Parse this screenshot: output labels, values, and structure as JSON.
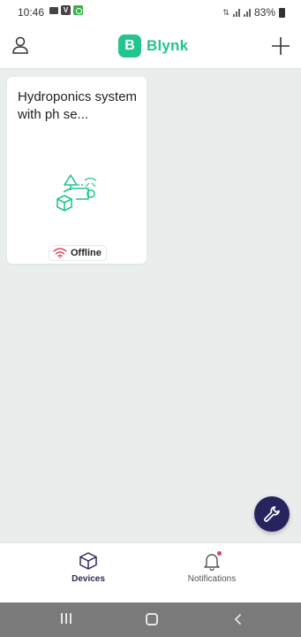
{
  "status_bar": {
    "time": "10:46",
    "battery": "83%",
    "icons": [
      "video-camera-icon",
      "v-app-icon",
      "green-app-icon",
      "data-arrows-icon",
      "signal-icon",
      "signal-icon",
      "battery-icon"
    ]
  },
  "header": {
    "logo_letter": "B",
    "app_name": "Blynk",
    "brand_color": "#23c48e"
  },
  "devices": [
    {
      "name": "Hydroponics system with ph se...",
      "status": "Offline",
      "status_color": "#e0405a"
    }
  ],
  "bottom_nav": {
    "items": [
      {
        "label": "Devices",
        "icon": "cube-icon",
        "active": true
      },
      {
        "label": "Notifications",
        "icon": "bell-icon",
        "active": false,
        "has_dot": true
      }
    ]
  },
  "fab": {
    "icon": "wrench-icon",
    "color": "#26235e"
  }
}
